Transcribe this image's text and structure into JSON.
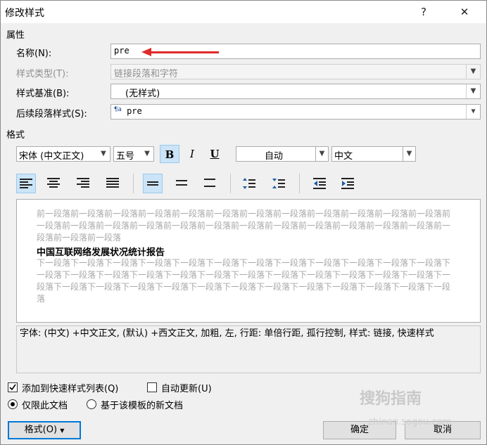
{
  "dialog": {
    "title": "修改样式",
    "help": "?",
    "close": "✕"
  },
  "properties": {
    "section": "属性",
    "name_label": "名称(N):",
    "name_value": "pre",
    "type_label": "样式类型(T):",
    "type_value": "链接段落和字符",
    "based_label": "样式基准(B):",
    "based_value": "(无样式)",
    "next_label": "后续段落样式(S):",
    "next_value": "pre",
    "next_icon": "¶a"
  },
  "format": {
    "section": "格式",
    "font": "宋体 (中文正文)",
    "size": "五号",
    "bold": "B",
    "italic": "I",
    "underline": "U",
    "color": "自动",
    "language": "中文"
  },
  "preview": {
    "before": "前一段落前一段落前一段落前一段落前一段落前一段落前一段落前一段落前一段落前一段落前一段落前一段落前一段落前一段落前一段落前一段落前一段落前一段落前一段落前一段落前一段落前一段落前一段落前一段落前一段落前一段落前一段落",
    "sample": "中国互联网络发展状况统计报告",
    "after": "下一段落下一段落下一段落下一段落下一段落下一段落下一段落下一段落下一段落下一段落下一段落下一段落下一段落下一段落下一段落下一段落下一段落下一段落下一段落下一段落下一段落下一段落下一段落下一段落下一段落下一段落下一段落下一段落下一段落下一段落下一段落下一段落下一段落下一段落下一段落下一段落下一段落"
  },
  "description": "字体: (中文) +中文正文, (默认) +西文正文, 加粗, 左, 行距: 单倍行距, 孤行控制, 样式: 链接, 快速样式",
  "options": {
    "add_quick": "添加到快速样式列表(Q)",
    "auto_update": "自动更新(U)",
    "only_doc": "仅限此文档",
    "new_docs": "基于该模板的新文档"
  },
  "buttons": {
    "format": "格式(O)",
    "ok": "确定",
    "cancel": "取消"
  },
  "watermark": {
    "brand": "搜狗指南",
    "url": "zhinan.sogou.com"
  },
  "colors": {
    "accent": "#0078d7",
    "annotation_arrow": "#e02a2a",
    "toggle_active": "#cce4f7"
  }
}
